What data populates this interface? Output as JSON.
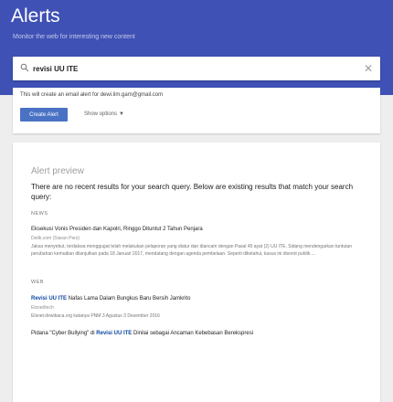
{
  "header": {
    "title": "Alerts",
    "subtitle": "Monitor the web for interesting new content"
  },
  "search": {
    "query": "revisi UU ITE"
  },
  "create": {
    "info": "This will create an email alert for dewi.lim.gam@gmail.com",
    "button_label": "Create Alert",
    "show_options_label": "Show options"
  },
  "preview": {
    "title": "Alert preview",
    "no_results": "There are no recent results for your search query. Below are existing results that match your search query:",
    "sections": [
      {
        "label": "NEWS",
        "results": [
          {
            "title": "Eksekusi Vonis Presiden dan Kapolri, Ringgo Dituntut 2 Tahun Penjara",
            "source": "Detik.com (Siaran Pers)",
            "snippet": "Jaksa menyebut, terdakwa menggugat telah melakukan pelaporan yang diatur dan diancam dengan Pasal 45 ayat (2) UU ITE. Sidang mendengarkan tuntutan perubahan kemudian dilanjutkan pada 18 Januari 2017, mendatang dengan agenda pembelaan. Seperti diketahui, kasus ini disorot publik ..."
          }
        ]
      },
      {
        "label": "WEB",
        "results": [
          {
            "title_bold": "Revisi UU ITE",
            "title_rest": " Nafas Lama Dalam Bungkus Baru Bersih Jamkrito",
            "source": "Elsnet/tech",
            "snippet": "Elsnet.dewibaca.org katanya PNM 3 Agustus 3 Desember 2016"
          },
          {
            "title_pre": "Pidana \"Cyber Bullying\" di ",
            "title_bold": "Revisi UU ITE",
            "title_rest": " Dinilai sebagai Ancaman Kebebasan Berekspresi"
          }
        ]
      }
    ]
  },
  "colors": {
    "header_bg": "#3f51b5",
    "button_bg": "#4a72c4",
    "page_bg": "#eeeeee"
  }
}
